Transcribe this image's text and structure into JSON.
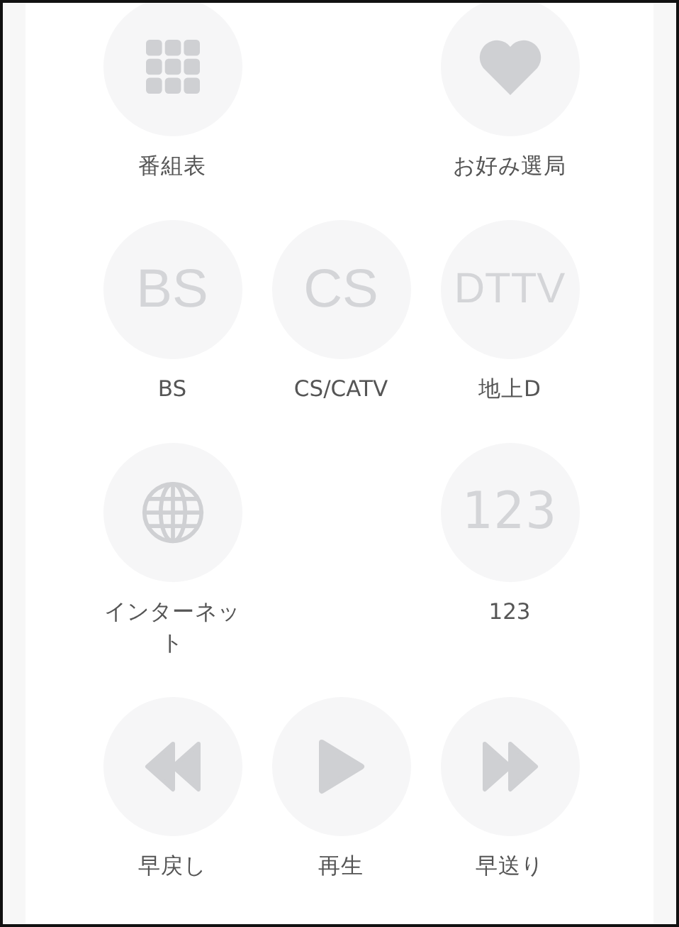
{
  "rows": [
    {
      "items": [
        {
          "kind": "grid",
          "label": "番組表"
        },
        {
          "kind": "spacer"
        },
        {
          "kind": "heart",
          "label": "お好み選局"
        }
      ]
    },
    {
      "items": [
        {
          "kind": "text",
          "icon_text": "BS",
          "label": "BS"
        },
        {
          "kind": "text",
          "icon_text": "CS",
          "label": "CS/CATV"
        },
        {
          "kind": "text",
          "icon_text": "DTTV",
          "label": "地上D"
        }
      ]
    },
    {
      "items": [
        {
          "kind": "globe",
          "label": "インターネット"
        },
        {
          "kind": "spacer"
        },
        {
          "kind": "digits",
          "icon_text": "123",
          "label": "123"
        }
      ]
    },
    {
      "items": [
        {
          "kind": "rewind",
          "label": "早戻し"
        },
        {
          "kind": "play",
          "label": "再生"
        },
        {
          "kind": "forward",
          "label": "早送り"
        }
      ]
    }
  ]
}
